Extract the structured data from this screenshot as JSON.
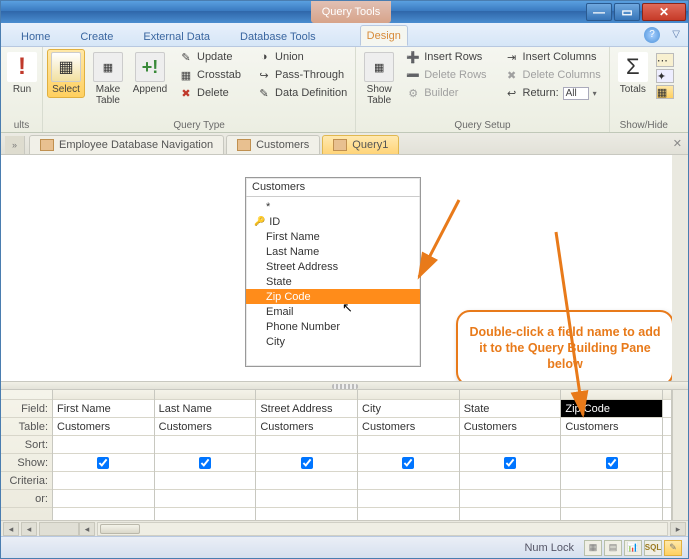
{
  "titlebar": {
    "query_tools": "Query Tools"
  },
  "tabs": {
    "home": "Home",
    "create": "Create",
    "external": "External Data",
    "dbtools": "Database Tools",
    "design": "Design"
  },
  "ribbon": {
    "results": {
      "label": "ults",
      "view": "",
      "run": "Run"
    },
    "querytype": {
      "label": "Query Type",
      "select": "Select",
      "maketable": "Make\nTable",
      "append": "Append",
      "update": "Update",
      "crosstab": "Crosstab",
      "delete": "Delete",
      "union": "Union",
      "passthrough": "Pass-Through",
      "datadef": "Data Definition"
    },
    "querysetup": {
      "label": "Query Setup",
      "showtable": "Show\nTable",
      "insertrows": "Insert Rows",
      "deleterows": "Delete Rows",
      "builder": "Builder",
      "insertcols": "Insert Columns",
      "deletecols": "Delete Columns",
      "return": "Return:",
      "return_val": "All"
    },
    "showhide": {
      "label": "Show/Hide",
      "totals": "Totals"
    }
  },
  "doctabs": {
    "t1": "Employee Database Navigation",
    "t2": "Customers",
    "t3": "Query1"
  },
  "fieldbox": {
    "title": "Customers",
    "all": "*",
    "fields": [
      "ID",
      "First Name",
      "Last Name",
      "Street Address",
      "State",
      "Zip Code",
      "Email",
      "Phone Number",
      "City"
    ]
  },
  "callout": "Double-click a field name to add it to the Query Building Pane below",
  "grid": {
    "rows": {
      "field": "Field:",
      "table": "Table:",
      "sort": "Sort:",
      "show": "Show:",
      "criteria": "Criteria:",
      "or": "or:"
    },
    "cols": [
      {
        "field": "First Name",
        "table": "Customers"
      },
      {
        "field": "Last Name",
        "table": "Customers"
      },
      {
        "field": "Street Address",
        "table": "Customers"
      },
      {
        "field": "City",
        "table": "Customers"
      },
      {
        "field": "State",
        "table": "Customers"
      },
      {
        "field": "Zip Code",
        "table": "Customers"
      }
    ]
  },
  "status": {
    "numlock": "Num Lock"
  }
}
